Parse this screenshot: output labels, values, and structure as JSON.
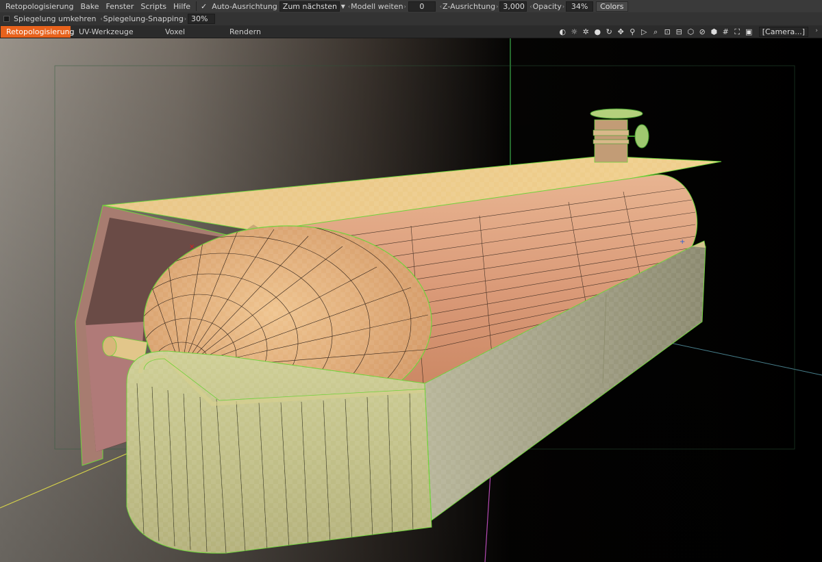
{
  "menu": {
    "items": [
      "Retopologisierung",
      "Bake",
      "Fenster",
      "Scripts",
      "Hilfe"
    ]
  },
  "toolbar": {
    "auto_align_check": "✓",
    "auto_align_label": "Auto-Ausrichtung",
    "snap_mode_value": "Zum nächsten P",
    "model_expand_label": "Modell weiten",
    "model_expand_value": "0",
    "z_align_label": "Z-Ausrichtung",
    "z_align_value": "3,000",
    "opacity_label": "Opacity",
    "opacity_value": "34%",
    "colors_button": "Colors"
  },
  "symmetry": {
    "mirror_invert_label": "Spiegelung umkehren",
    "mirror_snapping_label": "Spiegelung-Snapping",
    "mirror_snapping_value": "30%"
  },
  "rooms": {
    "tabs": [
      "Retopologisierung",
      "UV-Werkzeuge",
      "Voxel",
      "Rendern"
    ],
    "active": "Retopologisierung"
  },
  "viewport_toolbar": {
    "icons": [
      "contrast-icon",
      "lightbulb-icon",
      "light-settings-icon",
      "drop-icon",
      "rotate-icon",
      "move-icon",
      "zoom-icon",
      "play-icon",
      "search-icon",
      "all-icon",
      "frame-icon",
      "cube-outline-icon",
      "prohibit-icon",
      "cube-icon",
      "grid-icon",
      "fullscreen-icon",
      "screenshot-icon"
    ],
    "camera_value": "[Camera...]"
  },
  "colors": {
    "accent": "#e8621c",
    "wire_green": "#6fd23a"
  }
}
